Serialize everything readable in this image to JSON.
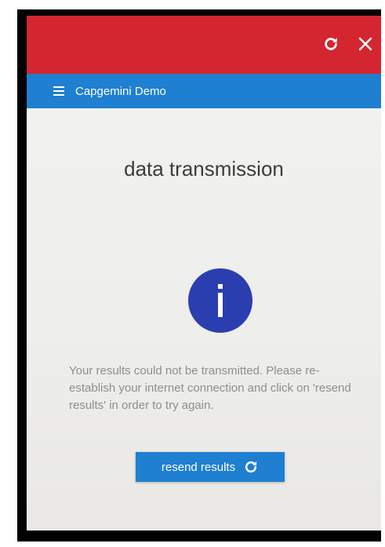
{
  "titlebar": {
    "color": "#d32630",
    "icons": {
      "reload": "reload-icon",
      "close": "close-icon"
    }
  },
  "appbar": {
    "app_name": "Capgemini Demo",
    "color": "#1f7fd0",
    "menu_icon": "hamburger-menu-icon"
  },
  "main": {
    "heading": "data transmission",
    "info_icon": "info-icon",
    "message": "Your results could not be transmitted. Please re-establish your internet connection and click on 'resend results' in order to try again.",
    "resend_button": {
      "label": "resend results",
      "icon": "refresh-icon"
    }
  }
}
